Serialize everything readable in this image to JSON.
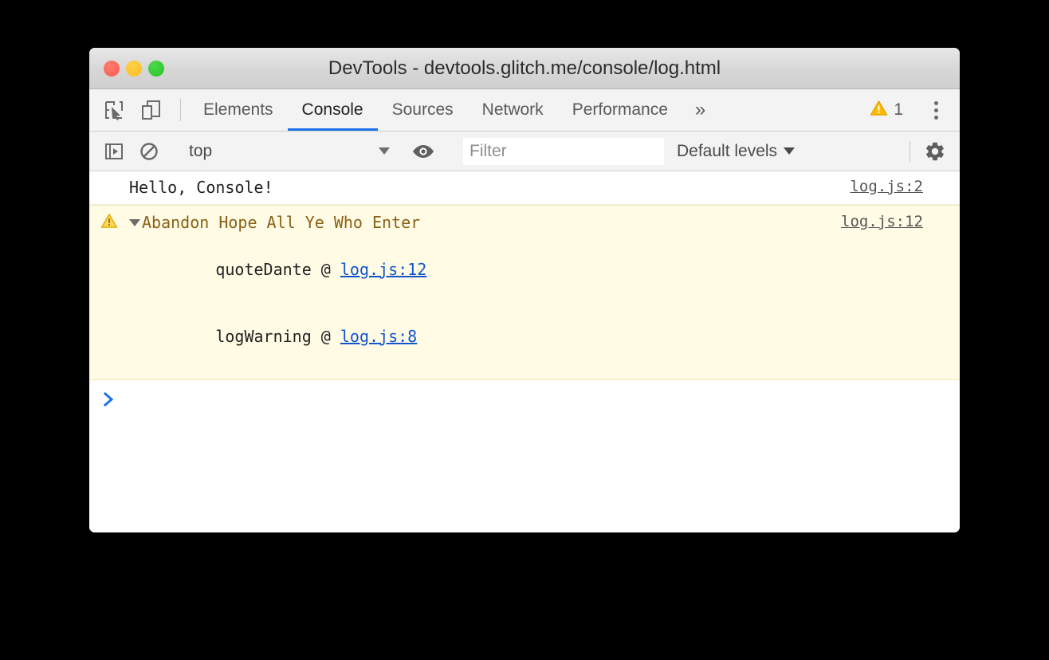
{
  "window": {
    "title": "DevTools - devtools.glitch.me/console/log.html",
    "traffic_lights": [
      "close-button",
      "minimize-button",
      "maximize-button"
    ]
  },
  "tabbar": {
    "inspect_icon": "inspect-element-icon",
    "device_icon": "device-toolbar-icon",
    "tabs": [
      {
        "label": "Elements",
        "active": false
      },
      {
        "label": "Console",
        "active": true
      },
      {
        "label": "Sources",
        "active": false
      },
      {
        "label": "Network",
        "active": false
      },
      {
        "label": "Performance",
        "active": false
      }
    ],
    "more_tabs_label": "»",
    "warning_icon": "warning-triangle-icon",
    "warning_count": "1",
    "menu_icon": "kebab-menu-icon"
  },
  "console_toolbar": {
    "sidebar_toggle_icon": "console-sidebar-toggle-icon",
    "clear_icon": "clear-console-icon",
    "context_value": "top",
    "context_caret_icon": "chevron-down-icon",
    "eye_icon": "live-expression-eye-icon",
    "filter_placeholder": "Filter",
    "filter_value": "",
    "levels_label": "Default levels",
    "levels_caret_icon": "chevron-down-icon",
    "settings_icon": "gear-icon"
  },
  "console": {
    "messages": [
      {
        "type": "log",
        "text": "Hello, Console!",
        "source": "log.js:2"
      },
      {
        "type": "warning",
        "icon": "warning-triangle-icon",
        "disclosure_icon": "triangle-down-icon",
        "text": "Abandon Hope All Ye Who Enter",
        "source": "log.js:12",
        "stack": [
          {
            "fn": "quoteDante @ ",
            "link": "log.js:12"
          },
          {
            "fn": "logWarning @ ",
            "link": "log.js:8"
          }
        ]
      }
    ],
    "prompt_icon": "prompt-chevron-icon",
    "prompt_value": ""
  },
  "colors": {
    "accent": "#1a73e8",
    "warning_bg": "#fffbe5",
    "warning_border": "#f0e6a8",
    "warning_text": "#8a6116",
    "link": "#1155cc"
  }
}
